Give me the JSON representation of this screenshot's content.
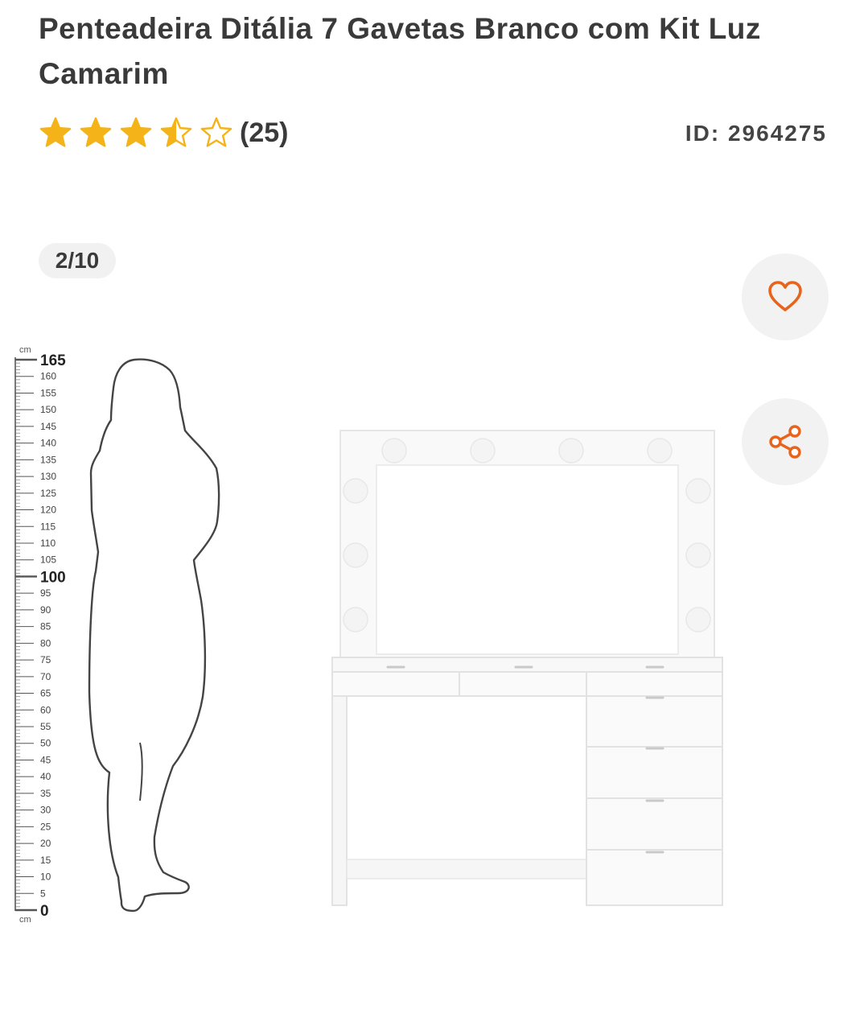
{
  "product": {
    "title": "Penteadeira Ditália 7 Gavetas Branco com Kit Luz Camarim",
    "rating": {
      "value": 3.5,
      "max": 5,
      "count_label": "(25)"
    },
    "id_label": "ID: 2964275"
  },
  "gallery": {
    "pager": "2/10",
    "scale": {
      "unit": "cm",
      "major_labels": [
        "165",
        "100",
        "0"
      ],
      "minor_labels": [
        "160",
        "155",
        "150",
        "145",
        "140",
        "135",
        "130",
        "125",
        "120",
        "115",
        "110",
        "105",
        "95",
        "90",
        "85",
        "80",
        "75",
        "70",
        "65",
        "60",
        "55",
        "50",
        "45",
        "40",
        "35",
        "30",
        "25",
        "20",
        "15",
        "10",
        "5"
      ]
    }
  },
  "actions": {
    "favorite_icon": "heart-icon",
    "share_icon": "share-icon"
  },
  "colors": {
    "star": "#f5b31a",
    "action_icon": "#e8641c",
    "button_bg": "#f2f2f2"
  }
}
